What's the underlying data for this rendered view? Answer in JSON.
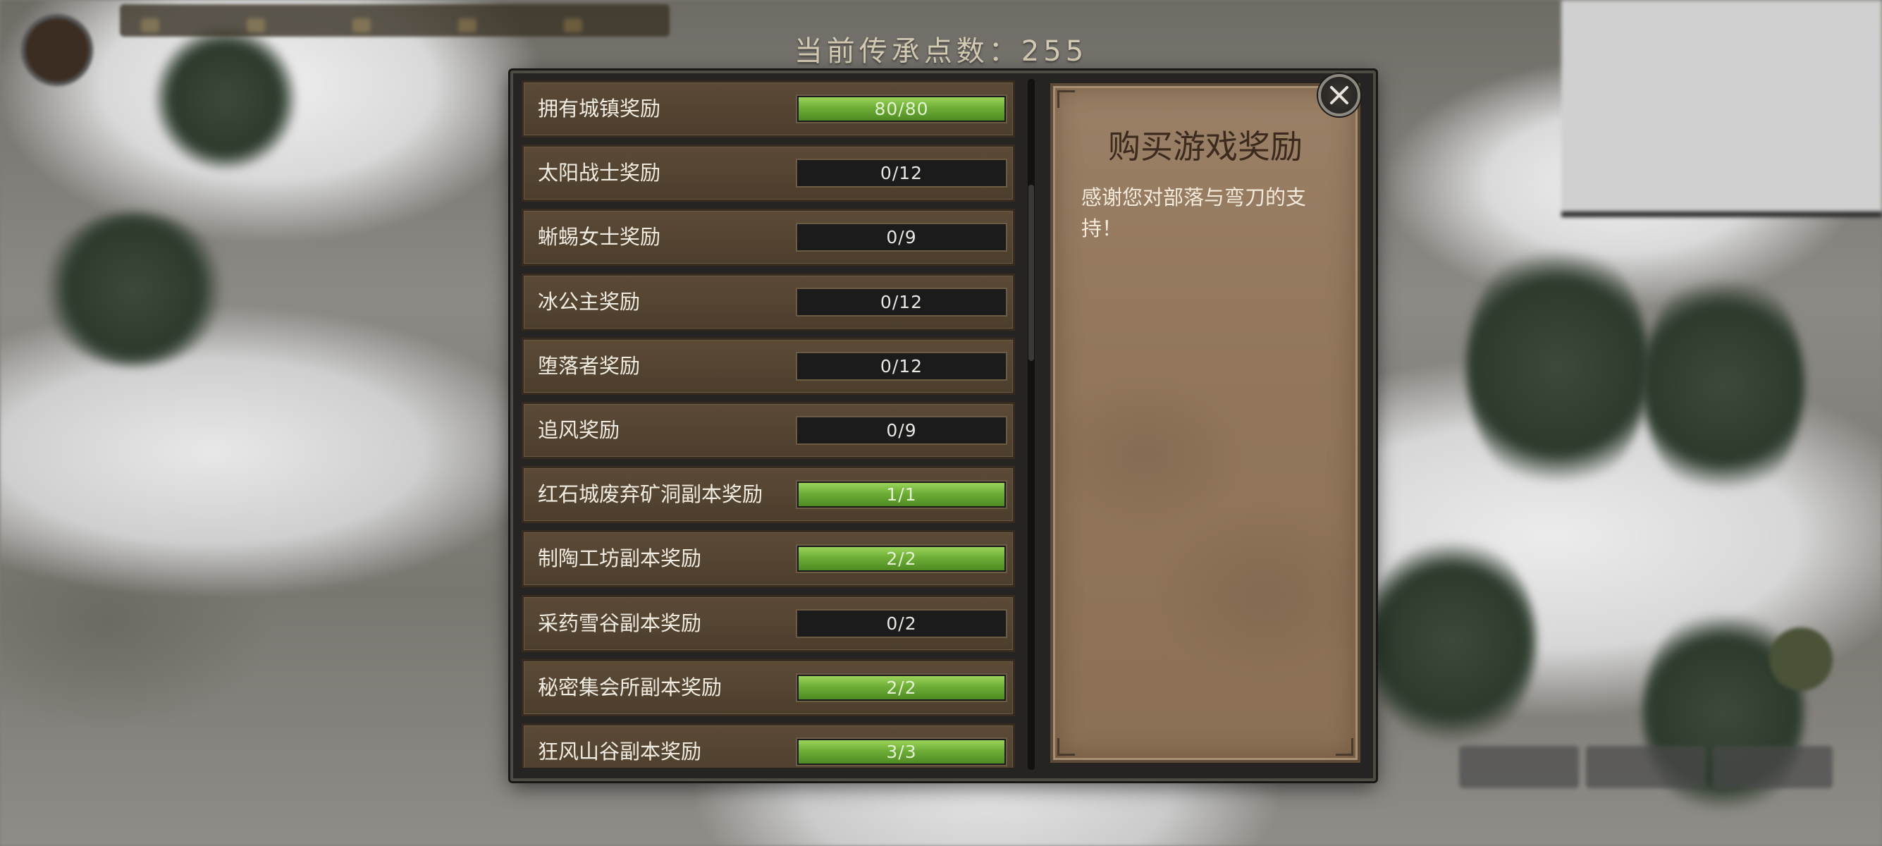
{
  "header": {
    "points_label": "当前传承点数：255"
  },
  "reward_list": [
    {
      "label": "拥有城镇奖励",
      "progress": "80/80",
      "current": 80,
      "max": 80
    },
    {
      "label": "太阳战士奖励",
      "progress": "0/12",
      "current": 0,
      "max": 12
    },
    {
      "label": "蜥蜴女士奖励",
      "progress": "0/9",
      "current": 0,
      "max": 9
    },
    {
      "label": "冰公主奖励",
      "progress": "0/12",
      "current": 0,
      "max": 12
    },
    {
      "label": "堕落者奖励",
      "progress": "0/12",
      "current": 0,
      "max": 12
    },
    {
      "label": "追风奖励",
      "progress": "0/9",
      "current": 0,
      "max": 9
    },
    {
      "label": "红石城废弃矿洞副本奖励",
      "progress": "1/1",
      "current": 1,
      "max": 1
    },
    {
      "label": "制陶工坊副本奖励",
      "progress": "2/2",
      "current": 2,
      "max": 2
    },
    {
      "label": "采药雪谷副本奖励",
      "progress": "0/2",
      "current": 0,
      "max": 2
    },
    {
      "label": "秘密集会所副本奖励",
      "progress": "2/2",
      "current": 2,
      "max": 2
    },
    {
      "label": "狂风山谷副本奖励",
      "progress": "3/3",
      "current": 3,
      "max": 3
    }
  ],
  "info_panel": {
    "title": "购买游戏奖励",
    "description": "感谢您对部落与弯刀的支持！"
  },
  "icons": {
    "close": "close-icon"
  },
  "colors": {
    "progress_fill": "#7cbf3f",
    "row_bg": "#57473a",
    "panel_bg": "#94795d"
  }
}
